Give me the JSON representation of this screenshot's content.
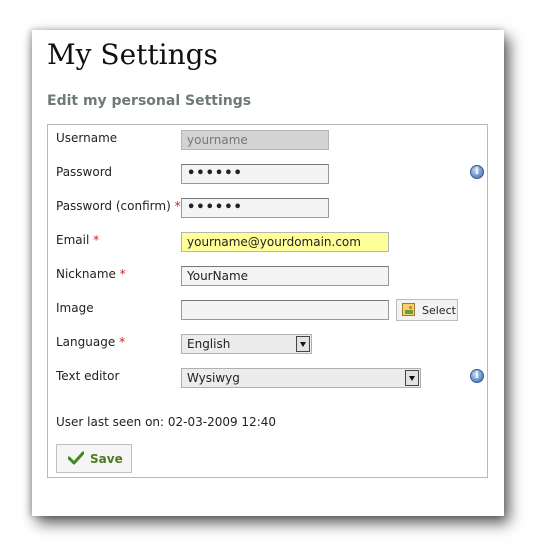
{
  "page": {
    "title": "My Settings",
    "subtitle": "Edit my personal Settings"
  },
  "form": {
    "username": {
      "label": "Username",
      "value": "yourname"
    },
    "password": {
      "label": "Password",
      "value": "••••••"
    },
    "password_confirm": {
      "label": "Password (confirm)",
      "required_mark": "*",
      "value": "••••••"
    },
    "email": {
      "label": "Email",
      "required_mark": "*",
      "value": "yourname@yourdomain.com"
    },
    "nickname": {
      "label": "Nickname",
      "required_mark": "*",
      "value": "YourName"
    },
    "image": {
      "label": "Image",
      "value": "",
      "select_label": "Select"
    },
    "language": {
      "label": "Language",
      "required_mark": "*",
      "value": "English"
    },
    "text_editor": {
      "label": "Text editor",
      "value": "Wysiwyg"
    },
    "info_glyph": "i",
    "last_seen": "User last seen on: 02-03-2009 12:40",
    "save_label": "Save"
  },
  "colors": {
    "required": "#cc2222",
    "email_highlight": "#ffff99",
    "save_text": "#4c7a1f",
    "subtitle": "#6e7a72"
  },
  "icons": {
    "info": "info-icon",
    "image_picker": "image-icon",
    "save": "checkmark-icon"
  }
}
